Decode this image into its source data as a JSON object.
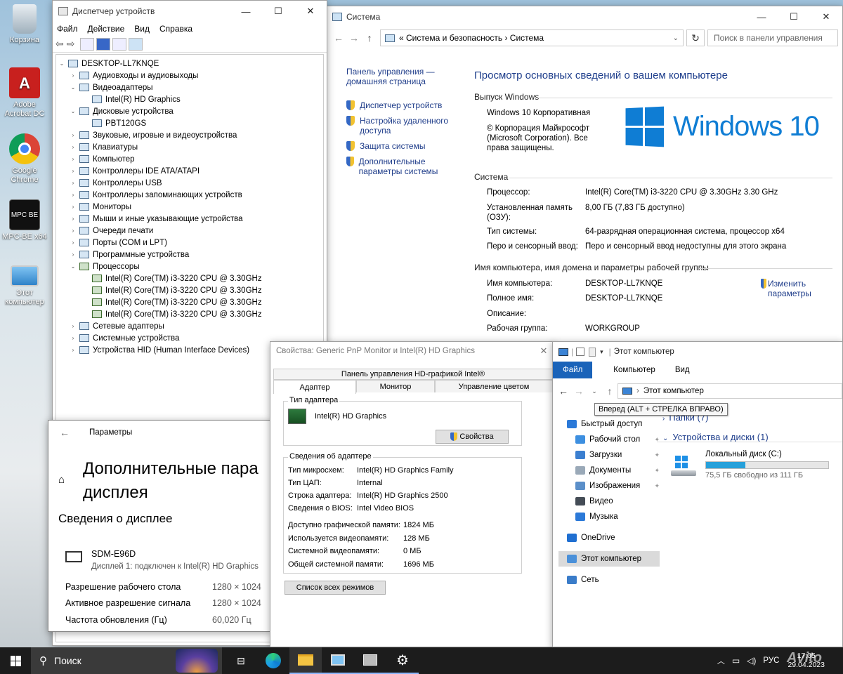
{
  "desktop": {
    "icons": [
      {
        "label": "Корзина"
      },
      {
        "label": "Adobe Acrobat DC"
      },
      {
        "label": "Google Chrome"
      },
      {
        "label": "MPC-BE x64"
      },
      {
        "label": "Этот компьютер"
      }
    ],
    "mpc_badge": "MPC BE"
  },
  "device_manager": {
    "title": "Диспетчер устройств",
    "menu": [
      "Файл",
      "Действие",
      "Вид",
      "Справка"
    ],
    "root": "DESKTOP-LL7KNQE",
    "items": [
      {
        "label": "Аудиовходы и аудиовыходы",
        "expander": "›",
        "level": 1
      },
      {
        "label": "Видеоадаптеры",
        "expander": "⌄",
        "level": 1
      },
      {
        "label": "Intel(R) HD Graphics",
        "expander": "",
        "level": 2
      },
      {
        "label": "Дисковые устройства",
        "expander": "⌄",
        "level": 1
      },
      {
        "label": "PBT120GS",
        "expander": "",
        "level": 2
      },
      {
        "label": "Звуковые, игровые и видеоустройства",
        "expander": "›",
        "level": 1
      },
      {
        "label": "Клавиатуры",
        "expander": "›",
        "level": 1
      },
      {
        "label": "Компьютер",
        "expander": "›",
        "level": 1
      },
      {
        "label": "Контроллеры IDE ATA/ATAPI",
        "expander": "›",
        "level": 1
      },
      {
        "label": "Контроллеры USB",
        "expander": "›",
        "level": 1
      },
      {
        "label": "Контроллеры запоминающих устройств",
        "expander": "›",
        "level": 1
      },
      {
        "label": "Мониторы",
        "expander": "›",
        "level": 1
      },
      {
        "label": "Мыши и иные указывающие устройства",
        "expander": "›",
        "level": 1
      },
      {
        "label": "Очереди печати",
        "expander": "›",
        "level": 1
      },
      {
        "label": "Порты (COM и LPT)",
        "expander": "›",
        "level": 1
      },
      {
        "label": "Программные устройства",
        "expander": "›",
        "level": 1
      },
      {
        "label": "Процессоры",
        "expander": "⌄",
        "level": 1
      },
      {
        "label": "Intel(R) Core(TM) i3-3220 CPU @ 3.30GHz",
        "expander": "",
        "level": 2
      },
      {
        "label": "Intel(R) Core(TM) i3-3220 CPU @ 3.30GHz",
        "expander": "",
        "level": 2
      },
      {
        "label": "Intel(R) Core(TM) i3-3220 CPU @ 3.30GHz",
        "expander": "",
        "level": 2
      },
      {
        "label": "Intel(R) Core(TM) i3-3220 CPU @ 3.30GHz",
        "expander": "",
        "level": 2
      },
      {
        "label": "Сетевые адаптеры",
        "expander": "›",
        "level": 1
      },
      {
        "label": "Системные устройства",
        "expander": "›",
        "level": 1
      },
      {
        "label": "Устройства HID (Human Interface Devices)",
        "expander": "›",
        "level": 1
      }
    ]
  },
  "system": {
    "title": "Система",
    "breadcrumb": "«  Система и безопасность  ›  Система",
    "search_placeholder": "Поиск в панели управления",
    "left_home": "Панель управления — домашняя страница",
    "left_links": [
      "Диспетчер устройств",
      "Настройка удаленного доступа",
      "Защита системы",
      "Дополнительные параметры системы"
    ],
    "heading": "Просмотр основных сведений о вашем компьютере",
    "edition_header": "Выпуск Windows",
    "edition": "Windows 10 Корпоративная",
    "copyright": "© Корпорация Майкрософт (Microsoft Corporation). Все права защищены.",
    "logo_text": "Windows 10",
    "system_header": "Система",
    "processor_label": "Процессор:",
    "processor_value": "Intel(R) Core(TM) i3-3220 CPU @ 3.30GHz   3.30 GHz",
    "ram_label": "Установленная память (ОЗУ):",
    "ram_value": "8,00 ГБ (7,83 ГБ доступно)",
    "type_label": "Тип системы:",
    "type_value": "64-разрядная операционная система, процессор x64",
    "pen_label": "Перо и сенсорный ввод:",
    "pen_value": "Перо и сенсорный ввод недоступны для этого экрана",
    "name_header": "Имя компьютера, имя домена и параметры рабочей группы",
    "computer_name_label": "Имя компьютера:",
    "computer_name_value": "DESKTOP-LL7KNQE",
    "full_name_label": "Полное имя:",
    "full_name_value": "DESKTOP-LL7KNQE",
    "description_label": "Описание:",
    "workgroup_label": "Рабочая группа:",
    "workgroup_value": "WORKGROUP",
    "change_link": "Изменить параметры"
  },
  "properties": {
    "title": "Свойства: Generic PnP Monitor и Intel(R) HD Graphics",
    "top_tab": "Панель управления HD-графикой Intel®",
    "tabs": [
      "Адаптер",
      "Монитор",
      "Управление цветом"
    ],
    "adapter_type_group": "Тип адаптера",
    "adapter_name": "Intel(R) HD Graphics",
    "properties_button": "Свойства",
    "info_group": "Сведения об адаптере",
    "info_rows": [
      {
        "label": "Тип микросхем:",
        "value": "Intel(R) HD Graphics Family"
      },
      {
        "label": "Тип ЦАП:",
        "value": "Internal"
      },
      {
        "label": "Строка адаптера:",
        "value": "Intel(R) HD Graphics 2500"
      },
      {
        "label": "Сведения о BIOS:",
        "value": "Intel Video BIOS"
      }
    ],
    "memory_rows": [
      {
        "label": "Доступно графической памяти:",
        "value": "1824 МБ"
      },
      {
        "label": "Используется видеопамяти:",
        "value": "128 МБ"
      },
      {
        "label": "Системной видеопамяти:",
        "value": "0 МБ"
      },
      {
        "label": "Общей системной памяти:",
        "value": "1696 МБ"
      }
    ],
    "list_modes_button": "Список всех режимов"
  },
  "settings": {
    "title": "Параметры",
    "heading": "Дополнительные пара­метры дисплея",
    "heading_line1": "Дополнительные пара",
    "heading_line2": "дисплея",
    "section": "Сведения о дисплее",
    "monitor_name": "SDM-E96D",
    "monitor_sub": "Дисплей 1: подключен к Intel(R) HD Graphics",
    "rows": [
      {
        "label": "Разрешение рабочего стола",
        "value": "1280 × 1024"
      },
      {
        "label": "Активное разрешение сигнала",
        "value": "1280 × 1024"
      },
      {
        "label": "Частота обновления (Гц)",
        "value": "60,020 Гц"
      }
    ]
  },
  "explorer": {
    "title": "Этот компьютер",
    "ribbon": [
      "Файл",
      "Компьютер",
      "Вид"
    ],
    "address": "Этот компьютер",
    "tooltip": "Вперед (ALT + СТРЕЛКА ВПРАВО)",
    "folders_header": "Папки (7)",
    "devices_header": "Устройства и диски (1)",
    "nav": [
      {
        "label": "Быстрый доступ",
        "pin": false,
        "indent": 0,
        "color": "#2b79d8"
      },
      {
        "label": "Рабочий стол",
        "pin": true,
        "indent": 1,
        "color": "#3d8fe0"
      },
      {
        "label": "Загрузки",
        "pin": true,
        "indent": 1,
        "color": "#3b7fd0"
      },
      {
        "label": "Документы",
        "pin": true,
        "indent": 1,
        "color": "#9aa9b8"
      },
      {
        "label": "Изображения",
        "pin": true,
        "indent": 1,
        "color": "#5b8fc9"
      },
      {
        "label": "Видео",
        "pin": false,
        "indent": 1,
        "color": "#444c56"
      },
      {
        "label": "Музыка",
        "pin": false,
        "indent": 1,
        "color": "#2b79d8"
      },
      {
        "label": "OneDrive",
        "pin": false,
        "indent": 0,
        "color": "#1f6fd1"
      },
      {
        "label": "Этот компьютер",
        "pin": false,
        "indent": 0,
        "color": "#4a90d9"
      },
      {
        "label": "Сеть",
        "pin": false,
        "indent": 0,
        "color": "#3a7cc9"
      }
    ],
    "drive_name": "Локальный диск (C:)",
    "drive_free": "75,5 ГБ свободно из 111 ГБ",
    "drive_used_fraction": 0.32
  },
  "taskbar": {
    "search": "Поиск",
    "lang": "РУС",
    "time": "17:05",
    "date": "29.04.2023",
    "watermark": "Avito"
  }
}
